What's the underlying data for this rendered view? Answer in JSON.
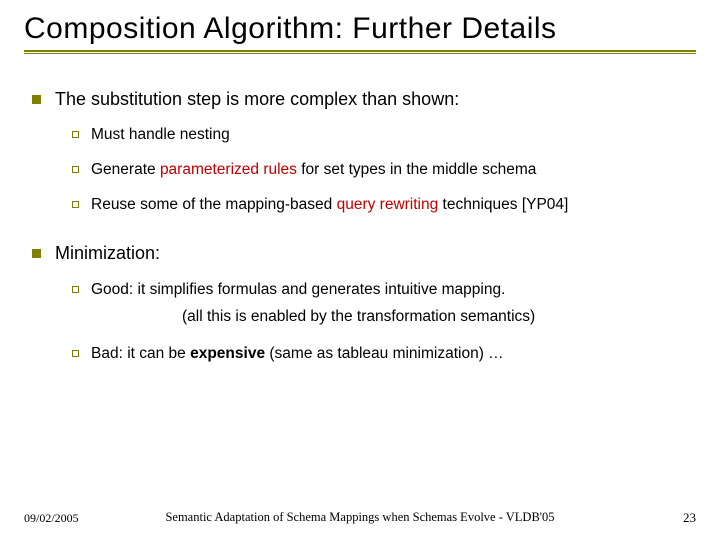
{
  "title": "Composition Algorithm: Further Details",
  "bullets": [
    {
      "text": "The substitution step is more complex than shown:",
      "subs": [
        {
          "segments": [
            {
              "t": "Must handle nesting"
            }
          ]
        },
        {
          "segments": [
            {
              "t": "Generate "
            },
            {
              "t": "parameterized rules",
              "cls": "accent"
            },
            {
              "t": " for set types in the middle schema"
            }
          ]
        },
        {
          "segments": [
            {
              "t": "Reuse some of the mapping-based "
            },
            {
              "t": "query rewriting",
              "cls": "accent"
            },
            {
              "t": " techniques [YP04]"
            }
          ]
        }
      ]
    },
    {
      "text": "Minimization:",
      "subs": [
        {
          "segments": [
            {
              "t": "Good: it simplifies formulas and generates intuitive mapping."
            }
          ],
          "note": "(all this is enabled by the transformation semantics)"
        },
        {
          "segments": [
            {
              "t": "Bad: it can be "
            },
            {
              "t": "expensive",
              "cls": "bold"
            },
            {
              "t": " (same as tableau minimization) …"
            }
          ]
        }
      ]
    }
  ],
  "footer": {
    "date": "09/02/2005",
    "center": "Semantic Adaptation of Schema Mappings when Schemas Evolve  -  VLDB'05",
    "page": "23"
  }
}
